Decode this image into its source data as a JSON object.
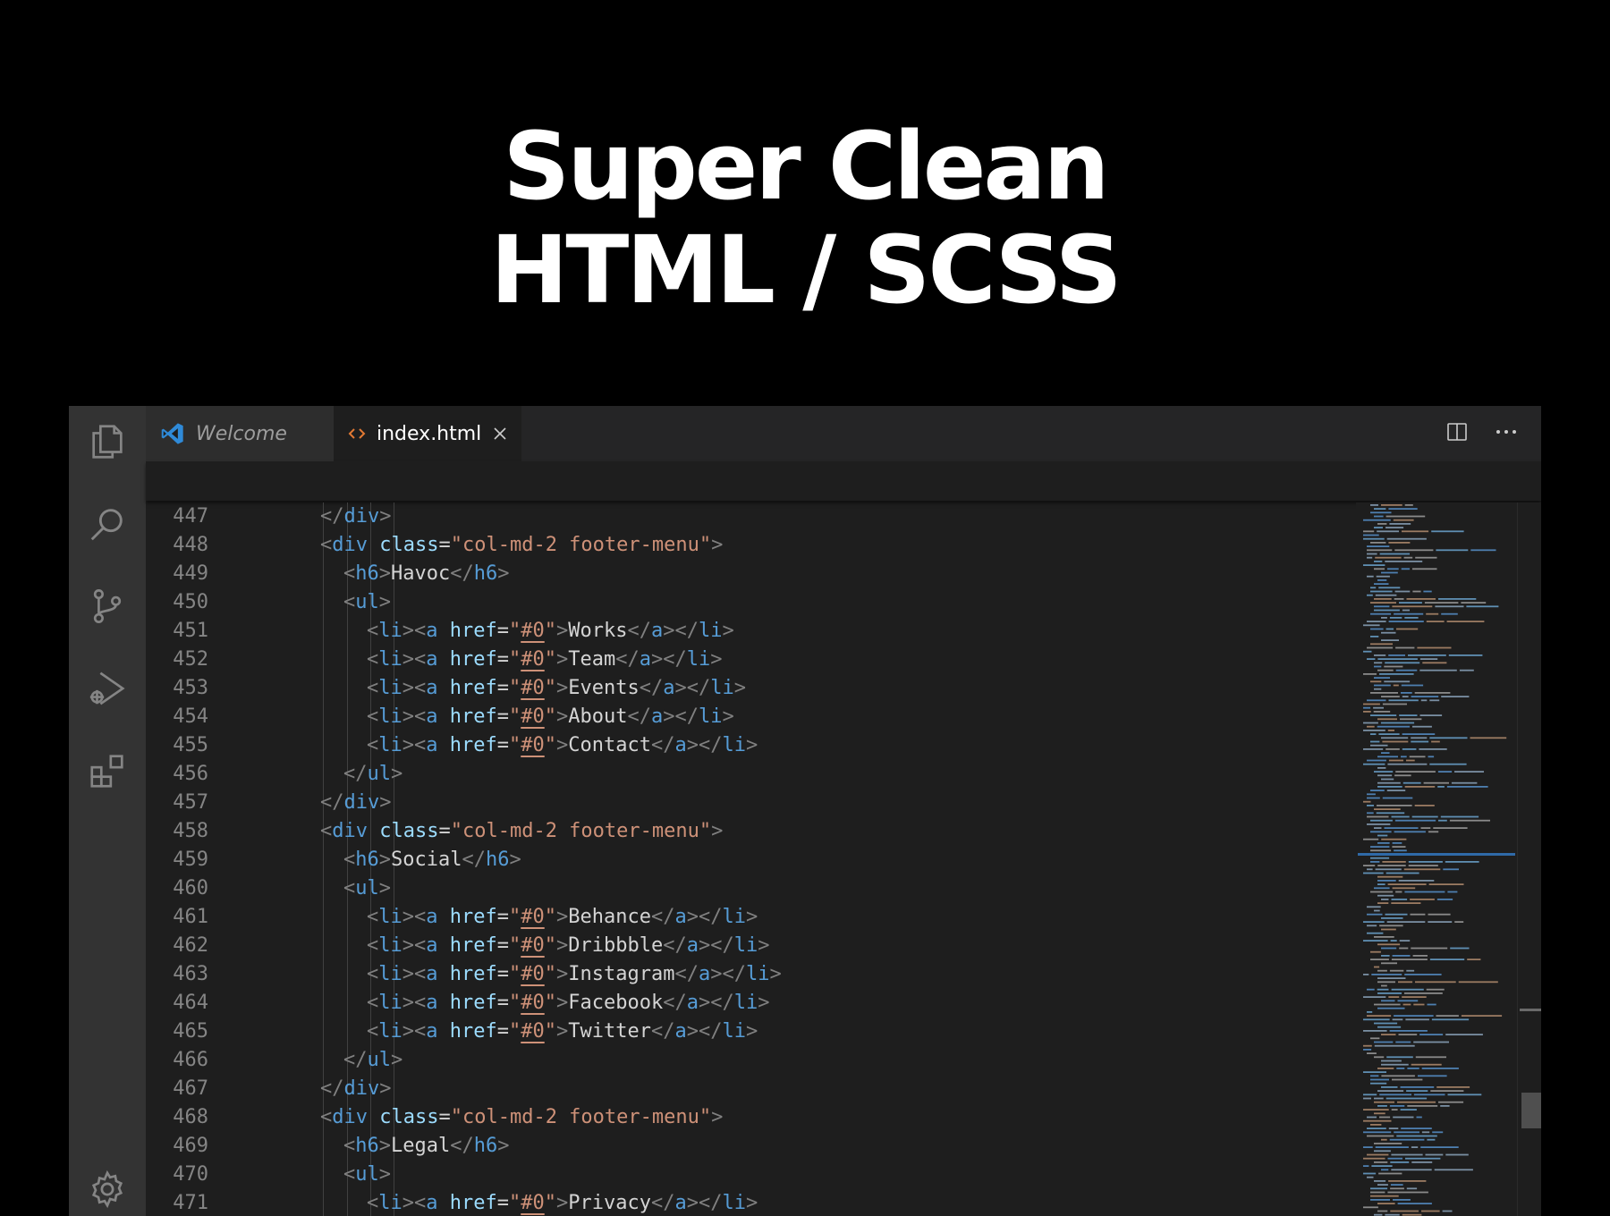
{
  "headline": {
    "line1": "Super Clean",
    "line2": "HTML / SCSS"
  },
  "tabs": [
    {
      "label": "Welcome",
      "icon": "vscode-logo-icon",
      "active": false
    },
    {
      "label": "index.html",
      "icon": "html-file-icon",
      "active": true
    }
  ],
  "activity_bar": [
    "explorer-icon",
    "search-icon",
    "source-control-icon",
    "run-debug-icon",
    "extensions-icon",
    "settings-gear-icon"
  ],
  "colors": {
    "tag": "#569cd6",
    "attr": "#9cdcfe",
    "string": "#ce9178",
    "text": "#d4d4d4",
    "bracket": "#808080",
    "line_number": "#858585",
    "accent": "#3c9fe0"
  },
  "code": [
    {
      "n": "447",
      "indent": 3,
      "tokens": [
        [
          "br",
          "</"
        ],
        [
          "tag",
          "div"
        ],
        [
          "br",
          ">"
        ]
      ]
    },
    {
      "n": "448",
      "indent": 3,
      "tokens": [
        [
          "br",
          "<"
        ],
        [
          "tag",
          "div"
        ],
        [
          "txt",
          " "
        ],
        [
          "attr",
          "class"
        ],
        [
          "txt",
          "="
        ],
        [
          "str",
          "\"col-md-2 footer-menu\""
        ],
        [
          "br",
          ">"
        ]
      ]
    },
    {
      "n": "449",
      "indent": 4,
      "tokens": [
        [
          "br",
          "<"
        ],
        [
          "tag",
          "h6"
        ],
        [
          "br",
          ">"
        ],
        [
          "txt",
          "Havoc"
        ],
        [
          "br",
          "</"
        ],
        [
          "tag",
          "h6"
        ],
        [
          "br",
          ">"
        ]
      ]
    },
    {
      "n": "450",
      "indent": 4,
      "tokens": [
        [
          "br",
          "<"
        ],
        [
          "tag",
          "ul"
        ],
        [
          "br",
          ">"
        ]
      ]
    },
    {
      "n": "451",
      "indent": 5,
      "tokens": [
        [
          "br",
          "<"
        ],
        [
          "tag",
          "li"
        ],
        [
          "br",
          "><"
        ],
        [
          "tag",
          "a"
        ],
        [
          "txt",
          " "
        ],
        [
          "attr",
          "href"
        ],
        [
          "txt",
          "="
        ],
        [
          "str",
          "\""
        ],
        [
          "hash",
          "#0"
        ],
        [
          "str",
          "\""
        ],
        [
          "br",
          ">"
        ],
        [
          "txt",
          "Works"
        ],
        [
          "br",
          "</"
        ],
        [
          "tag",
          "a"
        ],
        [
          "br",
          "></"
        ],
        [
          "tag",
          "li"
        ],
        [
          "br",
          ">"
        ]
      ]
    },
    {
      "n": "452",
      "indent": 5,
      "tokens": [
        [
          "br",
          "<"
        ],
        [
          "tag",
          "li"
        ],
        [
          "br",
          "><"
        ],
        [
          "tag",
          "a"
        ],
        [
          "txt",
          " "
        ],
        [
          "attr",
          "href"
        ],
        [
          "txt",
          "="
        ],
        [
          "str",
          "\""
        ],
        [
          "hash",
          "#0"
        ],
        [
          "str",
          "\""
        ],
        [
          "br",
          ">"
        ],
        [
          "txt",
          "Team"
        ],
        [
          "br",
          "</"
        ],
        [
          "tag",
          "a"
        ],
        [
          "br",
          "></"
        ],
        [
          "tag",
          "li"
        ],
        [
          "br",
          ">"
        ]
      ]
    },
    {
      "n": "453",
      "indent": 5,
      "tokens": [
        [
          "br",
          "<"
        ],
        [
          "tag",
          "li"
        ],
        [
          "br",
          "><"
        ],
        [
          "tag",
          "a"
        ],
        [
          "txt",
          " "
        ],
        [
          "attr",
          "href"
        ],
        [
          "txt",
          "="
        ],
        [
          "str",
          "\""
        ],
        [
          "hash",
          "#0"
        ],
        [
          "str",
          "\""
        ],
        [
          "br",
          ">"
        ],
        [
          "txt",
          "Events"
        ],
        [
          "br",
          "</"
        ],
        [
          "tag",
          "a"
        ],
        [
          "br",
          "></"
        ],
        [
          "tag",
          "li"
        ],
        [
          "br",
          ">"
        ]
      ]
    },
    {
      "n": "454",
      "indent": 5,
      "tokens": [
        [
          "br",
          "<"
        ],
        [
          "tag",
          "li"
        ],
        [
          "br",
          "><"
        ],
        [
          "tag",
          "a"
        ],
        [
          "txt",
          " "
        ],
        [
          "attr",
          "href"
        ],
        [
          "txt",
          "="
        ],
        [
          "str",
          "\""
        ],
        [
          "hash",
          "#0"
        ],
        [
          "str",
          "\""
        ],
        [
          "br",
          ">"
        ],
        [
          "txt",
          "About"
        ],
        [
          "br",
          "</"
        ],
        [
          "tag",
          "a"
        ],
        [
          "br",
          "></"
        ],
        [
          "tag",
          "li"
        ],
        [
          "br",
          ">"
        ]
      ]
    },
    {
      "n": "455",
      "indent": 5,
      "tokens": [
        [
          "br",
          "<"
        ],
        [
          "tag",
          "li"
        ],
        [
          "br",
          "><"
        ],
        [
          "tag",
          "a"
        ],
        [
          "txt",
          " "
        ],
        [
          "attr",
          "href"
        ],
        [
          "txt",
          "="
        ],
        [
          "str",
          "\""
        ],
        [
          "hash",
          "#0"
        ],
        [
          "str",
          "\""
        ],
        [
          "br",
          ">"
        ],
        [
          "txt",
          "Contact"
        ],
        [
          "br",
          "</"
        ],
        [
          "tag",
          "a"
        ],
        [
          "br",
          "></"
        ],
        [
          "tag",
          "li"
        ],
        [
          "br",
          ">"
        ]
      ]
    },
    {
      "n": "456",
      "indent": 4,
      "tokens": [
        [
          "br",
          "</"
        ],
        [
          "tag",
          "ul"
        ],
        [
          "br",
          ">"
        ]
      ]
    },
    {
      "n": "457",
      "indent": 3,
      "tokens": [
        [
          "br",
          "</"
        ],
        [
          "tag",
          "div"
        ],
        [
          "br",
          ">"
        ]
      ]
    },
    {
      "n": "458",
      "indent": 3,
      "tokens": [
        [
          "br",
          "<"
        ],
        [
          "tag",
          "div"
        ],
        [
          "txt",
          " "
        ],
        [
          "attr",
          "class"
        ],
        [
          "txt",
          "="
        ],
        [
          "str",
          "\"col-md-2 footer-menu\""
        ],
        [
          "br",
          ">"
        ]
      ]
    },
    {
      "n": "459",
      "indent": 4,
      "tokens": [
        [
          "br",
          "<"
        ],
        [
          "tag",
          "h6"
        ],
        [
          "br",
          ">"
        ],
        [
          "txt",
          "Social"
        ],
        [
          "br",
          "</"
        ],
        [
          "tag",
          "h6"
        ],
        [
          "br",
          ">"
        ]
      ]
    },
    {
      "n": "460",
      "indent": 4,
      "tokens": [
        [
          "br",
          "<"
        ],
        [
          "tag",
          "ul"
        ],
        [
          "br",
          ">"
        ]
      ]
    },
    {
      "n": "461",
      "indent": 5,
      "tokens": [
        [
          "br",
          "<"
        ],
        [
          "tag",
          "li"
        ],
        [
          "br",
          "><"
        ],
        [
          "tag",
          "a"
        ],
        [
          "txt",
          " "
        ],
        [
          "attr",
          "href"
        ],
        [
          "txt",
          "="
        ],
        [
          "str",
          "\""
        ],
        [
          "hash",
          "#0"
        ],
        [
          "str",
          "\""
        ],
        [
          "br",
          ">"
        ],
        [
          "txt",
          "Behance"
        ],
        [
          "br",
          "</"
        ],
        [
          "tag",
          "a"
        ],
        [
          "br",
          "></"
        ],
        [
          "tag",
          "li"
        ],
        [
          "br",
          ">"
        ]
      ]
    },
    {
      "n": "462",
      "indent": 5,
      "tokens": [
        [
          "br",
          "<"
        ],
        [
          "tag",
          "li"
        ],
        [
          "br",
          "><"
        ],
        [
          "tag",
          "a"
        ],
        [
          "txt",
          " "
        ],
        [
          "attr",
          "href"
        ],
        [
          "txt",
          "="
        ],
        [
          "str",
          "\""
        ],
        [
          "hash",
          "#0"
        ],
        [
          "str",
          "\""
        ],
        [
          "br",
          ">"
        ],
        [
          "txt",
          "Dribbble"
        ],
        [
          "br",
          "</"
        ],
        [
          "tag",
          "a"
        ],
        [
          "br",
          "></"
        ],
        [
          "tag",
          "li"
        ],
        [
          "br",
          ">"
        ]
      ]
    },
    {
      "n": "463",
      "indent": 5,
      "tokens": [
        [
          "br",
          "<"
        ],
        [
          "tag",
          "li"
        ],
        [
          "br",
          "><"
        ],
        [
          "tag",
          "a"
        ],
        [
          "txt",
          " "
        ],
        [
          "attr",
          "href"
        ],
        [
          "txt",
          "="
        ],
        [
          "str",
          "\""
        ],
        [
          "hash",
          "#0"
        ],
        [
          "str",
          "\""
        ],
        [
          "br",
          ">"
        ],
        [
          "txt",
          "Instagram"
        ],
        [
          "br",
          "</"
        ],
        [
          "tag",
          "a"
        ],
        [
          "br",
          "></"
        ],
        [
          "tag",
          "li"
        ],
        [
          "br",
          ">"
        ]
      ]
    },
    {
      "n": "464",
      "indent": 5,
      "tokens": [
        [
          "br",
          "<"
        ],
        [
          "tag",
          "li"
        ],
        [
          "br",
          "><"
        ],
        [
          "tag",
          "a"
        ],
        [
          "txt",
          " "
        ],
        [
          "attr",
          "href"
        ],
        [
          "txt",
          "="
        ],
        [
          "str",
          "\""
        ],
        [
          "hash",
          "#0"
        ],
        [
          "str",
          "\""
        ],
        [
          "br",
          ">"
        ],
        [
          "txt",
          "Facebook"
        ],
        [
          "br",
          "</"
        ],
        [
          "tag",
          "a"
        ],
        [
          "br",
          "></"
        ],
        [
          "tag",
          "li"
        ],
        [
          "br",
          ">"
        ]
      ]
    },
    {
      "n": "465",
      "indent": 5,
      "tokens": [
        [
          "br",
          "<"
        ],
        [
          "tag",
          "li"
        ],
        [
          "br",
          "><"
        ],
        [
          "tag",
          "a"
        ],
        [
          "txt",
          " "
        ],
        [
          "attr",
          "href"
        ],
        [
          "txt",
          "="
        ],
        [
          "str",
          "\""
        ],
        [
          "hash",
          "#0"
        ],
        [
          "str",
          "\""
        ],
        [
          "br",
          ">"
        ],
        [
          "txt",
          "Twitter"
        ],
        [
          "br",
          "</"
        ],
        [
          "tag",
          "a"
        ],
        [
          "br",
          "></"
        ],
        [
          "tag",
          "li"
        ],
        [
          "br",
          ">"
        ]
      ]
    },
    {
      "n": "466",
      "indent": 4,
      "tokens": [
        [
          "br",
          "</"
        ],
        [
          "tag",
          "ul"
        ],
        [
          "br",
          ">"
        ]
      ]
    },
    {
      "n": "467",
      "indent": 3,
      "tokens": [
        [
          "br",
          "</"
        ],
        [
          "tag",
          "div"
        ],
        [
          "br",
          ">"
        ]
      ]
    },
    {
      "n": "468",
      "indent": 3,
      "tokens": [
        [
          "br",
          "<"
        ],
        [
          "tag",
          "div"
        ],
        [
          "txt",
          " "
        ],
        [
          "attr",
          "class"
        ],
        [
          "txt",
          "="
        ],
        [
          "str",
          "\"col-md-2 footer-menu\""
        ],
        [
          "br",
          ">"
        ]
      ]
    },
    {
      "n": "469",
      "indent": 4,
      "tokens": [
        [
          "br",
          "<"
        ],
        [
          "tag",
          "h6"
        ],
        [
          "br",
          ">"
        ],
        [
          "txt",
          "Legal"
        ],
        [
          "br",
          "</"
        ],
        [
          "tag",
          "h6"
        ],
        [
          "br",
          ">"
        ]
      ]
    },
    {
      "n": "470",
      "indent": 4,
      "tokens": [
        [
          "br",
          "<"
        ],
        [
          "tag",
          "ul"
        ],
        [
          "br",
          ">"
        ]
      ]
    },
    {
      "n": "471",
      "indent": 5,
      "tokens": [
        [
          "br",
          "<"
        ],
        [
          "tag",
          "li"
        ],
        [
          "br",
          "><"
        ],
        [
          "tag",
          "a"
        ],
        [
          "txt",
          " "
        ],
        [
          "attr",
          "href"
        ],
        [
          "txt",
          "="
        ],
        [
          "str",
          "\""
        ],
        [
          "hash",
          "#0"
        ],
        [
          "str",
          "\""
        ],
        [
          "br",
          ">"
        ],
        [
          "txt",
          "Privacy"
        ],
        [
          "br",
          "</"
        ],
        [
          "tag",
          "a"
        ],
        [
          "br",
          "></"
        ],
        [
          "tag",
          "li"
        ],
        [
          "br",
          ">"
        ]
      ]
    }
  ]
}
